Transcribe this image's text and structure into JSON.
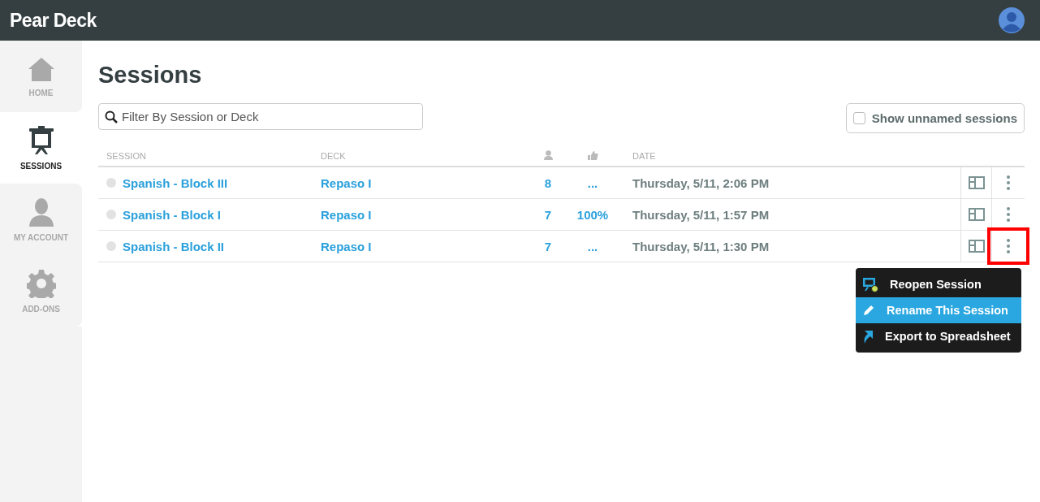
{
  "header": {
    "logo": "Pear Deck"
  },
  "sidebar": {
    "items": [
      {
        "label": "HOME",
        "kind": "home",
        "selected": false
      },
      {
        "label": "SESSIONS",
        "kind": "sessions",
        "selected": true
      },
      {
        "label": "MY ACCOUNT",
        "kind": "account",
        "selected": false
      },
      {
        "label": "ADD-ONS",
        "kind": "addons",
        "selected": false
      }
    ]
  },
  "page_title": "Sessions",
  "search": {
    "placeholder": "Filter By Session or Deck"
  },
  "show_unnamed": {
    "label": "Show unnamed sessions",
    "checked": false
  },
  "table": {
    "columns": [
      "SESSION",
      "DECK",
      "DATE"
    ],
    "rows": [
      {
        "session": "Spanish - Block III",
        "deck": "Repaso I",
        "students": "8",
        "score": "...",
        "date": "Thursday, 5/11, 2:06 PM",
        "highlighted": false
      },
      {
        "session": "Spanish - Block I",
        "deck": "Repaso I",
        "students": "7",
        "score": "100%",
        "date": "Thursday, 5/11, 1:57 PM",
        "highlighted": false
      },
      {
        "session": "Spanish - Block II",
        "deck": "Repaso I",
        "students": "7",
        "score": "...",
        "date": "Thursday, 5/11, 1:30 PM",
        "highlighted": true
      }
    ]
  },
  "menu": {
    "items": [
      {
        "label": "Reopen Session",
        "kind": "reopen",
        "selected": false
      },
      {
        "label": "Rename This Session",
        "kind": "rename",
        "selected": true
      },
      {
        "label": "Export to Spreadsheet",
        "kind": "export",
        "selected": false
      }
    ]
  }
}
